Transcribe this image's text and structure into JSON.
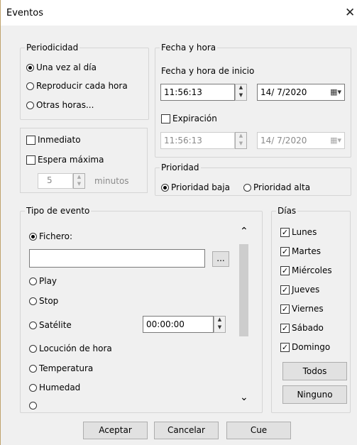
{
  "window": {
    "title": "Eventos",
    "close": "✕"
  },
  "periodicidad": {
    "legend": "Periodicidad",
    "options": [
      "Una vez al día",
      "Reproducir cada hora",
      "Otras horas..."
    ],
    "selected": 0
  },
  "inmediato": {
    "label": "Inmediato"
  },
  "espera": {
    "label": "Espera máxima",
    "value": "5",
    "unit": "minutos"
  },
  "fecha": {
    "legend": "Fecha y hora",
    "inicio_label": "Fecha y hora de inicio",
    "inicio_time": "11:56:13",
    "inicio_date": "14/ 7/2020",
    "expiracion_label": "Expiración",
    "exp_time": "11:56:13",
    "exp_date": "14/ 7/2020"
  },
  "prioridad": {
    "legend": "Prioridad",
    "options": [
      "Prioridad baja",
      "Prioridad alta"
    ],
    "selected": 0
  },
  "tipo": {
    "legend": "Tipo de evento",
    "fichero_label": "Fichero:",
    "fichero_value": "",
    "browse": "...",
    "options": [
      "Play",
      "Stop",
      "Satélite",
      "Locución de hora",
      "Temperatura",
      "Humedad"
    ],
    "satelite_time": "00:00:00"
  },
  "dias": {
    "legend": "Días",
    "items": [
      "Lunes",
      "Martes",
      "Miércoles",
      "Jueves",
      "Viernes",
      "Sábado",
      "Domingo"
    ],
    "checked": [
      true,
      true,
      true,
      true,
      true,
      true,
      true
    ],
    "todos": "Todos",
    "ninguno": "Ninguno"
  },
  "buttons": {
    "aceptar": "Aceptar",
    "cancelar": "Cancelar",
    "cue": "Cue"
  },
  "icons": {
    "check": "✓",
    "up": "▲",
    "down": "▼",
    "calendar": "▦▾",
    "scroll_up": "⌃",
    "scroll_down": "⌄"
  }
}
